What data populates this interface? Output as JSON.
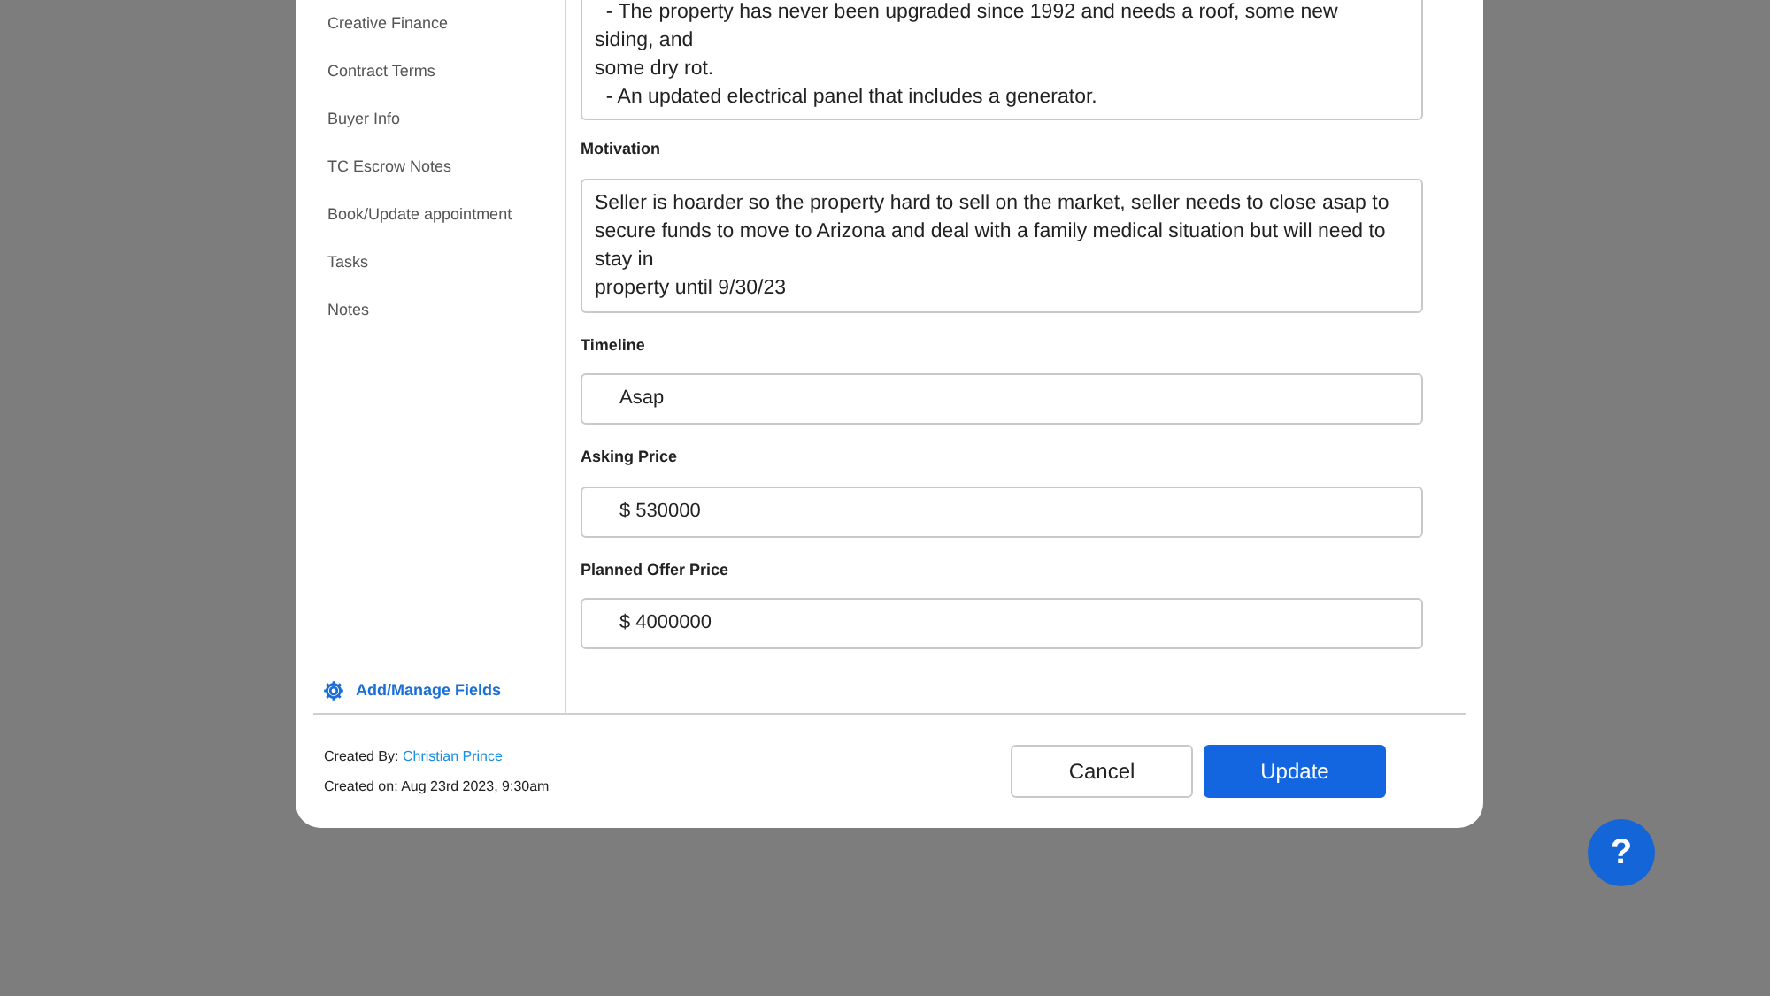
{
  "sidebar": {
    "items": [
      {
        "label": "Creative Finance"
      },
      {
        "label": "Contract Terms"
      },
      {
        "label": "Buyer Info"
      },
      {
        "label": "TC Escrow Notes"
      },
      {
        "label": "Book/Update appointment"
      },
      {
        "label": "Tasks"
      },
      {
        "label": "Notes"
      }
    ],
    "manage_link": "Add/Manage Fields"
  },
  "fields": [
    {
      "kind": "textarea",
      "value": "  - The property has never been upgraded since 1992 and needs a roof, some new siding, and\nsome dry rot.\n  - An updated electrical panel that includes a generator."
    },
    {
      "kind": "textarea",
      "label": "Motivation",
      "value": "Seller is hoarder so the property hard to sell on the market, seller needs to close asap to secure funds to move to Arizona and deal with a family medical situation but will need to stay in\nproperty until 9/30/23"
    },
    {
      "kind": "input",
      "label": "Timeline",
      "value": "Asap"
    },
    {
      "kind": "input",
      "label": "Asking Price",
      "value": "$ 530000"
    },
    {
      "kind": "input",
      "label": "Planned Offer Price",
      "value": "$ 4000000"
    }
  ],
  "footer": {
    "created_by_label": "Created By:",
    "created_by": "Christian Prince",
    "created_on": "Created on: Aug 23rd 2023, 9:30am",
    "buttons": [
      {
        "label": "Cancel",
        "kind": "secondary"
      },
      {
        "label": "Update",
        "kind": "primary"
      }
    ]
  },
  "help_button": "?"
}
